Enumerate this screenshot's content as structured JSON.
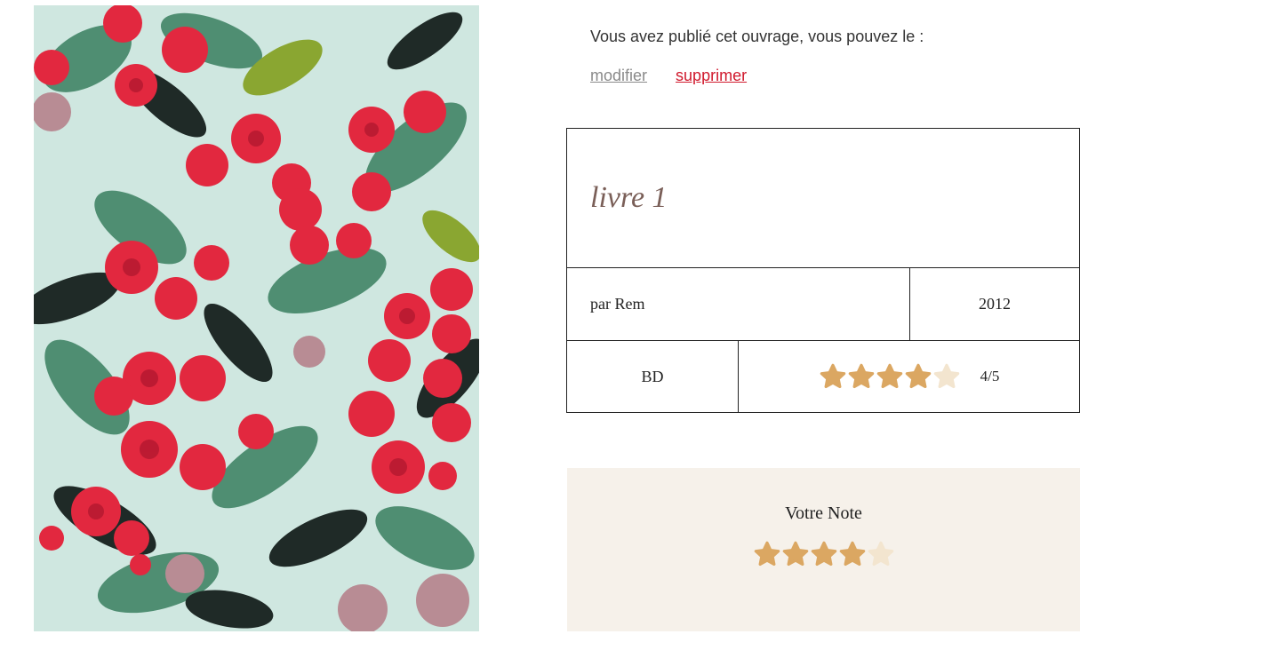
{
  "cover": {
    "alt": "Couverture du livre"
  },
  "owner_note": "Vous avez publié cet ouvrage, vous pouvez le :",
  "actions": {
    "edit_label": "modifier",
    "delete_label": "supprimer"
  },
  "book": {
    "title": "livre 1",
    "author": "par Rem",
    "year": "2012",
    "genre": "BD",
    "average_rating": 4,
    "rating_max": 5,
    "rating_text": "4/5"
  },
  "user_vote": {
    "title": "Votre Note",
    "value": 4,
    "max": 5
  },
  "colors": {
    "star_filled": "#dba762",
    "star_empty": "#f3e5cf",
    "delete_link": "#d0192d",
    "vote_bg": "#f6f1ea"
  },
  "icons": {
    "star": "star-icon"
  }
}
